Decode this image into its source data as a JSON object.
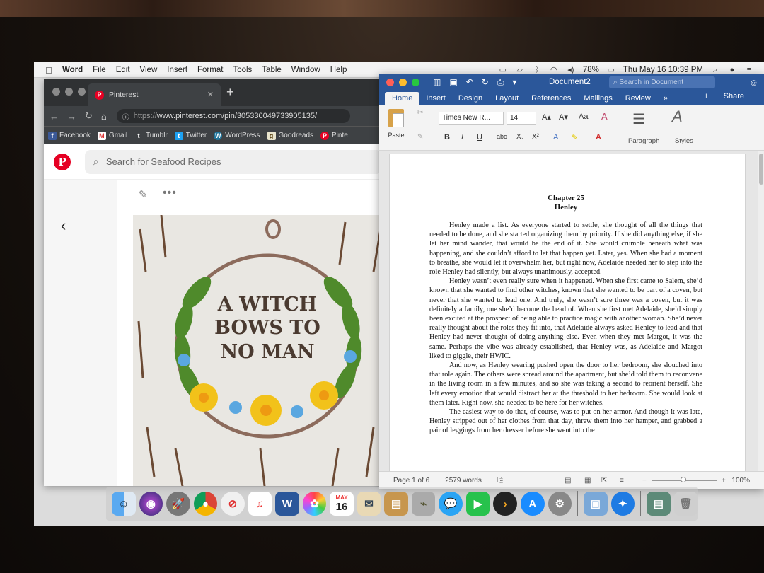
{
  "menubar": {
    "app": "Word",
    "items": [
      "File",
      "Edit",
      "View",
      "Insert",
      "Format",
      "Tools",
      "Table",
      "Window",
      "Help"
    ],
    "battery": "78%",
    "datetime": "Thu May 16  10:39 PM"
  },
  "browser": {
    "tab_title": "Pinterest",
    "url_prefix": "https://",
    "url_host": "www.pinterest.com/pin/305330049733905135/",
    "bookmarks": [
      "Facebook",
      "Gmail",
      "Tumblr",
      "Twitter",
      "WordPress",
      "Goodreads",
      "Pinte"
    ],
    "search_placeholder": "Search for Seafood Recipes",
    "pin_image_text": [
      "A WITCH",
      "BOWS TO",
      "NO MAN"
    ]
  },
  "word": {
    "doc_title": "Document2",
    "search_placeholder": "Search in Document",
    "tabs": [
      "Home",
      "Insert",
      "Design",
      "Layout",
      "References",
      "Mailings",
      "Review"
    ],
    "share": "Share",
    "font": "Times New R...",
    "size": "14",
    "paste_label": "Paste",
    "paragraph_label": "Paragraph",
    "styles_label": "Styles",
    "chapter": "Chapter 25",
    "chapter_name": "Henley",
    "paragraphs": [
      "Henley made a list.  As everyone started to settle, she thought of all the things that needed to be done, and she started organizing them by priority.  If she did anything else, if she let her mind wander, that would be the end of it.  She would crumble beneath what was happening, and she couldn’t afford to let that happen yet.  Later, yes.  When she had a moment to breathe, she would let it overwhelm her, but right now, Adelaide needed her to step into the role Henley had silently, but always unanimously, accepted.",
      "Henley wasn’t even really sure when it happened.  When she first came to Salem, she’d known that she wanted to find other witches, known that she wanted to be part of a coven, but never that she wanted to lead one.  And truly, she wasn’t sure three was a coven, but it was definitely a family, one she’d become the head of.  When she first met Adelaide, she’d simply been excited at the prospect of being able to practice magic with another woman.  She’d never really thought about the roles they fit into, that Adelaide always asked Henley to lead and that Henley had never thought of doing anything else.  Even when they met Margot, it was the same.  Perhaps the vibe was already established, that Henley was, as Adelaide and Margot liked to giggle, their HWIC.",
      "And now, as Henley wearing pushed open the door to her bedroom, she slouched into that role again.  The others were spread around the apartment, but she’d told them to reconvene in the living room in a few minutes, and so she was taking a second to reorient herself.  She left every emotion that would distract her at the threshold to her bedroom.  She would look at them later.  Right now, she needed to be here for her witches.",
      "The easiest way to do that, of course, was to put on her armor.  And though it was late, Henley stripped out of her clothes from that day, threw them into her hamper, and grabbed a pair of leggings from her dresser before she went into the"
    ],
    "status_page": "Page 1 of 6",
    "status_words": "2579 words",
    "zoom": "100%"
  },
  "dock": {
    "calendar_month": "MAY",
    "calendar_day": "16"
  }
}
